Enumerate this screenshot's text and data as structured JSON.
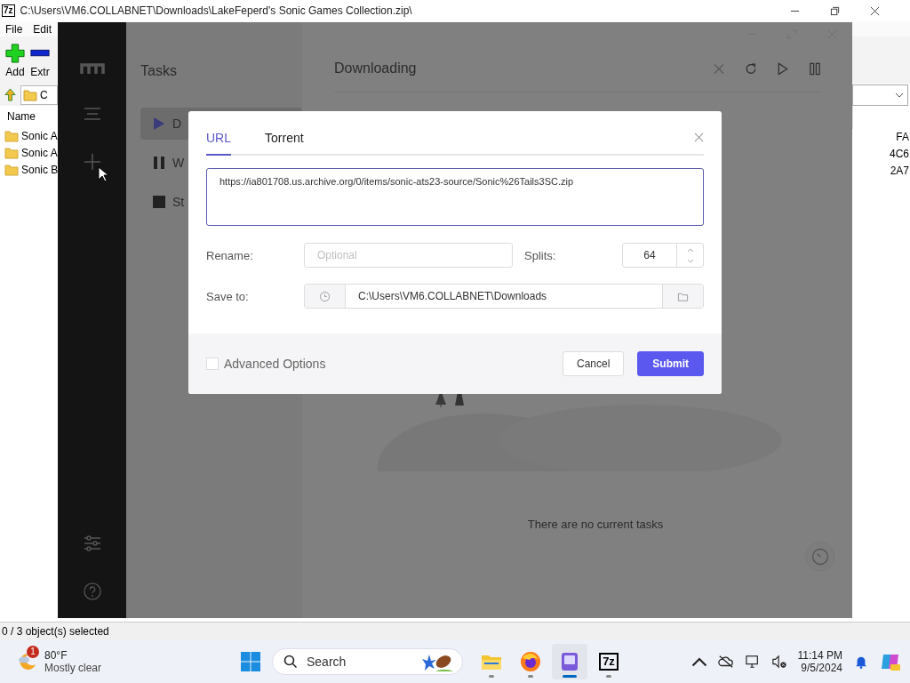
{
  "archive_window": {
    "icon_label": "7z",
    "title": "C:\\Users\\VM6.COLLABNET\\Downloads\\LakeFeperd's Sonic Games Collection.zip\\",
    "menu": [
      "File",
      "Edit"
    ],
    "toolbar": [
      {
        "kind": "add",
        "label": "Add"
      },
      {
        "kind": "extract",
        "label": "Extr"
      }
    ],
    "address": "C",
    "columns": [
      "Name"
    ],
    "rows": [
      {
        "name": "Sonic A",
        "column_2": "FA"
      },
      {
        "name": "Sonic A",
        "column_2": "4C6"
      },
      {
        "name": "Sonic B",
        "column_2": "2A7"
      }
    ],
    "status_bar": "0 / 3 object(s) selected"
  },
  "download_manager": {
    "tasks_title": "Tasks",
    "task_filters": [
      {
        "kind": "active",
        "label": "D",
        "selected": true
      },
      {
        "kind": "waiting",
        "label": "W",
        "selected": false
      },
      {
        "kind": "stopped",
        "label": "St",
        "selected": false
      }
    ],
    "header": "Downloading",
    "empty_message": "There are no current tasks"
  },
  "dialog": {
    "tabs": [
      {
        "label": "URL",
        "selected": true
      },
      {
        "label": "Torrent",
        "selected": false
      }
    ],
    "url": "https://ia801708.us.archive.org/0/items/sonic-ats23-source/Sonic%26Tails3SC.zip",
    "rename": {
      "label": "Rename:",
      "placeholder": "Optional"
    },
    "splits": {
      "label": "Splits:",
      "value": "64"
    },
    "save_to": {
      "label": "Save to:",
      "value": "C:\\Users\\VM6.COLLABNET\\Downloads"
    },
    "advanced": {
      "label": "Advanced Options",
      "checked": false
    },
    "buttons": [
      {
        "kind": "secondary",
        "label": "Cancel"
      },
      {
        "kind": "primary",
        "label": "Submit"
      }
    ]
  },
  "taskbar": {
    "weather": {
      "badge": "1",
      "temperature": "80°F",
      "condition": "Mostly clear"
    },
    "search": {
      "placeholder": "Search"
    },
    "apps": [
      {
        "kind": "files",
        "selected": false
      },
      {
        "kind": "browser",
        "selected": false
      },
      {
        "kind": "downloader",
        "selected": true
      },
      {
        "kind": "archiver",
        "label": "7z",
        "selected": false
      }
    ],
    "time": "11:14 PM",
    "date": "9/5/2024"
  }
}
